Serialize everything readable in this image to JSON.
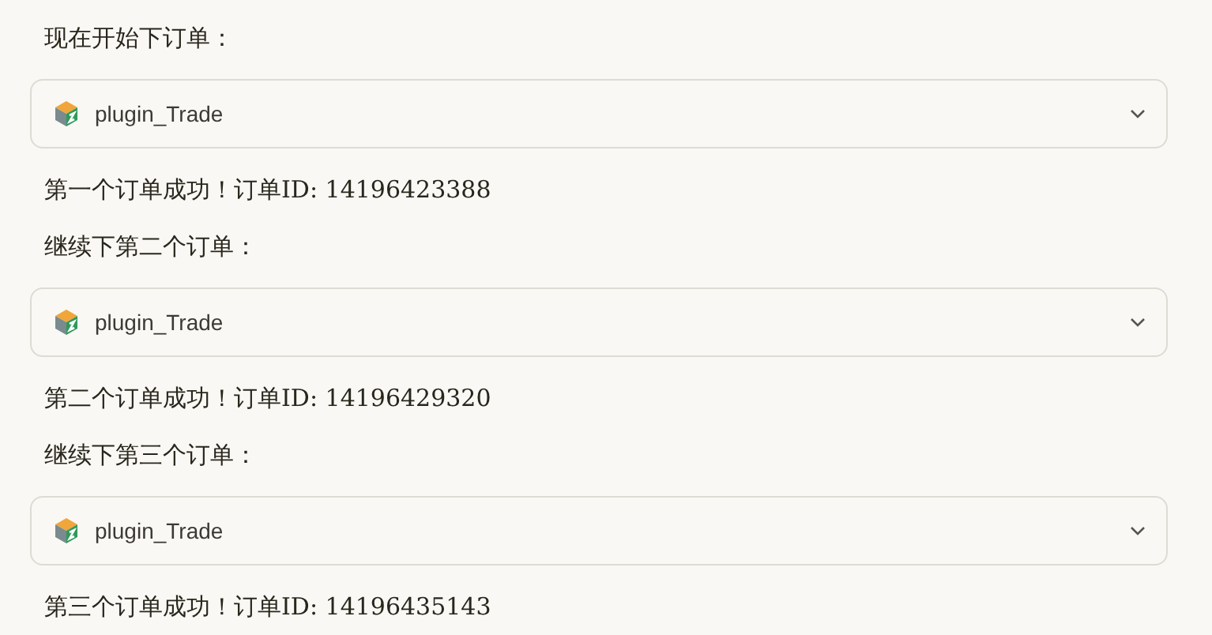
{
  "messages": [
    {
      "kind": "text",
      "text": "现在开始下订单："
    },
    {
      "kind": "tool",
      "name": "plugin_Trade"
    },
    {
      "kind": "text",
      "text": "第一个订单成功！订单ID: 14196423388"
    },
    {
      "kind": "text",
      "text": "继续下第二个订单："
    },
    {
      "kind": "tool",
      "name": "plugin_Trade"
    },
    {
      "kind": "text",
      "text": "第二个订单成功！订单ID: 14196429320"
    },
    {
      "kind": "text",
      "text": "继续下第三个订单："
    },
    {
      "kind": "tool",
      "name": "plugin_Trade"
    },
    {
      "kind": "text",
      "text": "第三个订单成功！订单ID: 14196435143"
    }
  ]
}
